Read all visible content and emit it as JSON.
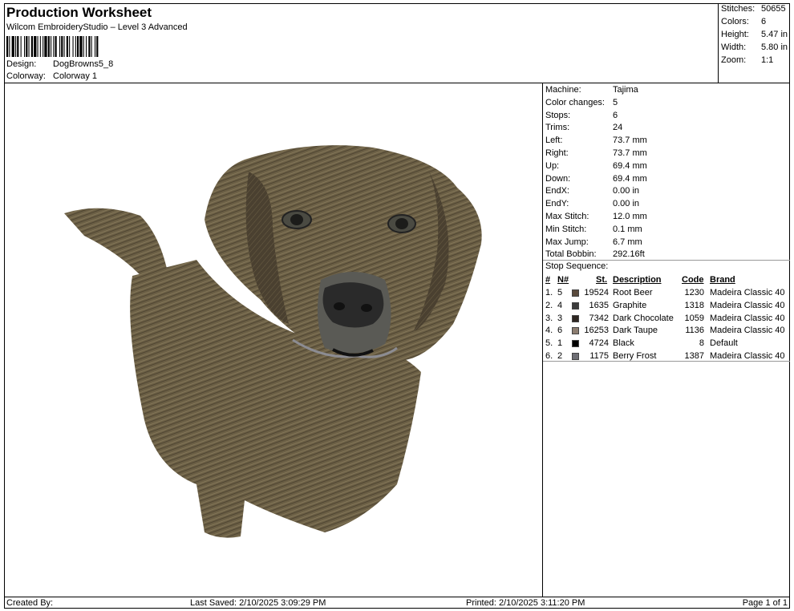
{
  "header": {
    "title": "Production Worksheet",
    "software": "Wilcom EmbroideryStudio – Level 3 Advanced",
    "design_label": "Design:",
    "design_value": "DogBrowns5_8",
    "colorway_label": "Colorway:",
    "colorway_value": "Colorway 1"
  },
  "stats": [
    {
      "label": "Stitches:",
      "value": "50655"
    },
    {
      "label": "Colors:",
      "value": "6"
    },
    {
      "label": "Height:",
      "value": "5.47 in"
    },
    {
      "label": "Width:",
      "value": "5.80 in"
    },
    {
      "label": "Zoom:",
      "value": "1:1"
    }
  ],
  "machine_info": [
    {
      "label": "Machine:",
      "value": "Tajima"
    },
    {
      "label": "Color changes:",
      "value": "5"
    },
    {
      "label": "Stops:",
      "value": "6"
    },
    {
      "label": "Trims:",
      "value": "24"
    },
    {
      "label": "Left:",
      "value": "73.7 mm"
    },
    {
      "label": "Right:",
      "value": "73.7 mm"
    },
    {
      "label": "Up:",
      "value": "69.4 mm"
    },
    {
      "label": "Down:",
      "value": "69.4 mm"
    },
    {
      "label": "EndX:",
      "value": "0.00 in"
    },
    {
      "label": "EndY:",
      "value": "0.00 in"
    },
    {
      "label": "Max Stitch:",
      "value": "12.0 mm"
    },
    {
      "label": "Min Stitch:",
      "value": "0.1 mm"
    },
    {
      "label": "Max Jump:",
      "value": "6.7 mm"
    },
    {
      "label": "Total Bobbin:",
      "value": "292.16ft"
    }
  ],
  "stop_sequence": {
    "label": "Stop Sequence:",
    "headers": {
      "num": "#",
      "n": "N#",
      "st": "St.",
      "desc": "Description",
      "code": "Code",
      "brand": "Brand"
    },
    "rows": [
      {
        "num": "1.",
        "n": "5",
        "color": "#5a4a3c",
        "st": "19524",
        "desc": "Root Beer",
        "code": "1230",
        "brand": "Madeira Classic 40"
      },
      {
        "num": "2.",
        "n": "4",
        "color": "#3c3c3c",
        "st": "1635",
        "desc": "Graphite",
        "code": "1318",
        "brand": "Madeira Classic 40"
      },
      {
        "num": "3.",
        "n": "3",
        "color": "#2e2722",
        "st": "7342",
        "desc": "Dark Chocolate",
        "code": "1059",
        "brand": "Madeira Classic 40"
      },
      {
        "num": "4.",
        "n": "6",
        "color": "#8c7d70",
        "st": "16253",
        "desc": "Dark Taupe",
        "code": "1136",
        "brand": "Madeira Classic 40"
      },
      {
        "num": "5.",
        "n": "1",
        "color": "#000000",
        "st": "4724",
        "desc": "Black",
        "code": "8",
        "brand": "Default"
      },
      {
        "num": "6.",
        "n": "2",
        "color": "#6e6e74",
        "st": "1175",
        "desc": "Berry Frost",
        "code": "1387",
        "brand": "Madeira Classic 40"
      }
    ]
  },
  "footer": {
    "created_by": "Created By:",
    "last_saved": "Last Saved: 2/10/2025 3:09:29 PM",
    "printed": "Printed: 2/10/2025 3:11:20 PM",
    "page": "Page 1 of 1"
  },
  "colors": {
    "fur_main": "#6b5f45",
    "fur_dark": "#4a4030",
    "fur_light": "#8a7d5e",
    "nose": "#2a2a2a",
    "muzzle": "#555"
  }
}
